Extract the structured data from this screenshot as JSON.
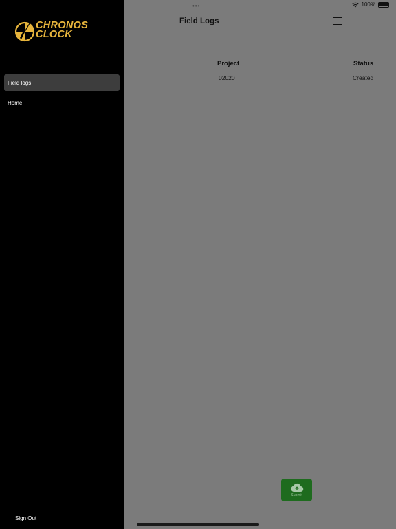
{
  "status_bar": {
    "dots": "•••",
    "battery_text": "100%"
  },
  "header": {
    "title": "Field Logs",
    "menu_icon": "hamburger-icon"
  },
  "table": {
    "columns": [
      "Project",
      "Status"
    ],
    "rows": [
      {
        "project": "02020",
        "status": "Created"
      }
    ]
  },
  "submit_button": {
    "label": "Submit",
    "icon": "cloud-upload-icon",
    "color": "#1e6b1e"
  },
  "sidebar": {
    "logo_lines": [
      "CHRONOS",
      "CLOCK"
    ],
    "logo_color": "#e6b43c",
    "items": [
      {
        "label": "Field logs",
        "active": true
      },
      {
        "label": "Home",
        "active": false
      }
    ],
    "sign_out_label": "Sign Out"
  }
}
